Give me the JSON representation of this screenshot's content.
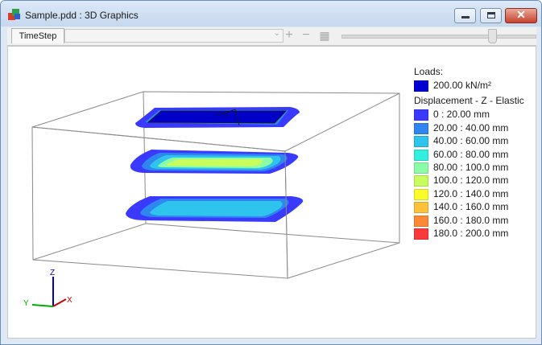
{
  "window": {
    "title": "Sample.pdd : 3D Graphics",
    "min_icon": "minimize-icon",
    "max_icon": "maximize-icon",
    "close_icon": "close-icon",
    "close_glyph": "✕"
  },
  "toolbar": {
    "tab_label": "TimeStep",
    "combo_value": "",
    "icons": {
      "dropdown": "chevron-down-icon",
      "add": "plus-icon",
      "remove": "minus-icon",
      "film": "film-strip-icon"
    },
    "add_glyph": "+",
    "remove_glyph": "−",
    "film_glyph": "▦",
    "arrow_glyph": "⌄",
    "slider_value": 0.78
  },
  "axes": {
    "z_label": "Z",
    "y_label": "Y",
    "x_label": "X"
  },
  "legend": {
    "loads_title": "Loads:",
    "load_item": {
      "label": "200.00 kN/m²",
      "color": "#0000d0"
    },
    "displacement_title": "Displacement - Z - Elastic",
    "items": [
      {
        "label": "0 : 20.00 mm",
        "color": "#3a3aff"
      },
      {
        "label": "20.00 : 40.00 mm",
        "color": "#2f86f0"
      },
      {
        "label": "40.00 : 60.00 mm",
        "color": "#2ec4ee"
      },
      {
        "label": "60.00 : 80.00 mm",
        "color": "#33f0de"
      },
      {
        "label": "80.00 : 100.0 mm",
        "color": "#8dfca6"
      },
      {
        "label": "100.0 : 120.0 mm",
        "color": "#c8fd5e"
      },
      {
        "label": "120.0 : 140.0 mm",
        "color": "#fbfb2a"
      },
      {
        "label": "140.0 : 160.0 mm",
        "color": "#fcc33a"
      },
      {
        "label": "160.0 : 180.0 mm",
        "color": "#fb8935"
      },
      {
        "label": "180.0 : 200.0 mm",
        "color": "#fa3a3a"
      }
    ]
  }
}
